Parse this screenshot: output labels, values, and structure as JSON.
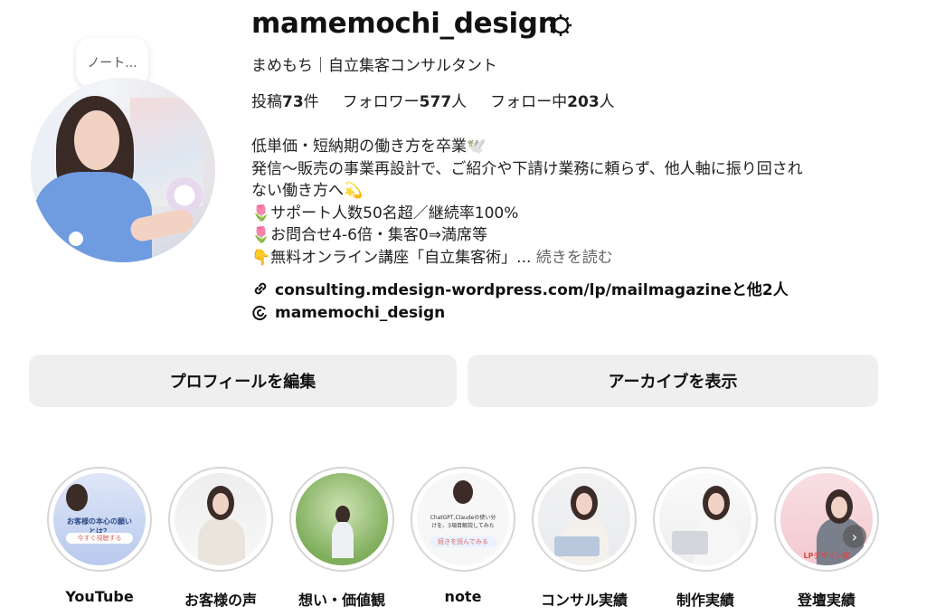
{
  "note": {
    "text": "ノート..."
  },
  "profile": {
    "username": "mamemochi_design",
    "display_name": "まめもち｜自立集客コンサルタント",
    "stats": {
      "posts_label": "投稿",
      "posts_count": "73",
      "posts_unit": "件",
      "followers_label": "フォロワー",
      "followers_count": "577",
      "followers_unit": "人",
      "following_label": "フォロー中",
      "following_count": "203",
      "following_unit": "人"
    },
    "bio": [
      "低単価・短納期の働き方を卒業🕊️",
      "発信〜販売の事業再設計で、ご紹介や下請け業務に頼らず、他人軸に振り回され",
      "ない働き方へ💫",
      "🌷サポート人数50名超／継続率100%",
      "🌷お問合せ4-6倍・集客0⇒満席等",
      "👇無料オンライン講座「自立集客術」..."
    ],
    "read_more": "続きを読む",
    "link": "consulting.mdesign-wordpress.com/lp/mailmagazineと他2人",
    "threads_handle": "mamemochi_design"
  },
  "buttons": {
    "edit_profile": "プロフィールを編集",
    "view_archive": "アーカイブを表示"
  },
  "highlights": [
    {
      "label": "YouTube",
      "thumb_text": "お客様の本心の願いとは？",
      "thumb_chip": "今すぐ視聴する"
    },
    {
      "label": "お客様の声"
    },
    {
      "label": "想い・価値観"
    },
    {
      "label": "note",
      "thumb_text": "ChatGPT,Claudeの使い分けを、3項目解説してみた",
      "thumb_chip": "続きを読んでみる"
    },
    {
      "label": "コンサル実績"
    },
    {
      "label": "制作実績"
    },
    {
      "label": "登壇実績",
      "thumb_text": "LPデザイン実"
    }
  ],
  "icons": [
    "gear-icon",
    "link-icon",
    "threads-icon",
    "chevron-right-icon"
  ]
}
